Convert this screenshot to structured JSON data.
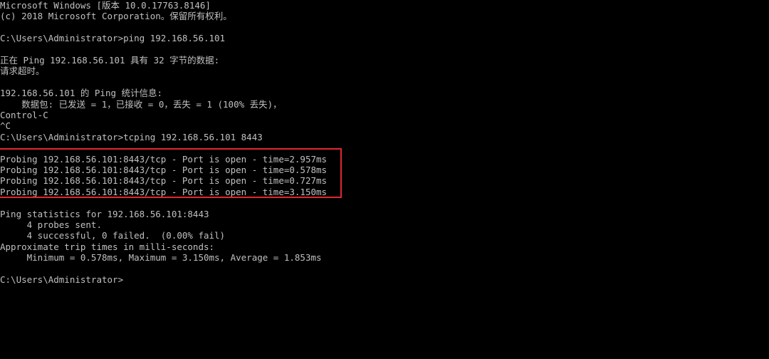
{
  "terminal": {
    "lines": [
      {
        "row": 0,
        "text": "Microsoft Windows [版本 10.0.17763.8146]"
      },
      {
        "row": 1,
        "text": "(c) 2018 Microsoft Corporation。保留所有权利。"
      },
      {
        "row": 2,
        "text": ""
      },
      {
        "row": 3,
        "text": "C:\\Users\\Administrator>ping 192.168.56.101"
      },
      {
        "row": 4,
        "text": ""
      },
      {
        "row": 5,
        "text": "正在 Ping 192.168.56.101 具有 32 字节的数据:"
      },
      {
        "row": 6,
        "text": "请求超时。"
      },
      {
        "row": 7,
        "text": ""
      },
      {
        "row": 8,
        "text": "192.168.56.101 的 Ping 统计信息:"
      },
      {
        "row": 9,
        "text": "    数据包: 已发送 = 1，已接收 = 0，丢失 = 1 (100% 丢失)，"
      },
      {
        "row": 10,
        "text": "Control-C"
      },
      {
        "row": 11,
        "text": "^C"
      },
      {
        "row": 12,
        "text": "C:\\Users\\Administrator>tcping 192.168.56.101 8443"
      },
      {
        "row": 13,
        "text": ""
      },
      {
        "row": 14,
        "text": "Probing 192.168.56.101:8443/tcp - Port is open - time=2.957ms"
      },
      {
        "row": 15,
        "text": "Probing 192.168.56.101:8443/tcp - Port is open - time=0.578ms"
      },
      {
        "row": 16,
        "text": "Probing 192.168.56.101:8443/tcp - Port is open - time=0.727ms"
      },
      {
        "row": 17,
        "text": "Probing 192.168.56.101:8443/tcp - Port is open - time=3.150ms"
      },
      {
        "row": 18,
        "text": ""
      },
      {
        "row": 19,
        "text": "Ping statistics for 192.168.56.101:8443"
      },
      {
        "row": 20,
        "text": "     4 probes sent."
      },
      {
        "row": 21,
        "text": "     4 successful, 0 failed.  (0.00% fail)"
      },
      {
        "row": 22,
        "text": "Approximate trip times in milli-seconds:"
      },
      {
        "row": 23,
        "text": "     Minimum = 0.578ms, Maximum = 3.150ms, Average = 1.853ms"
      },
      {
        "row": 24,
        "text": ""
      },
      {
        "row": 25,
        "text": "C:\\Users\\Administrator>"
      }
    ]
  },
  "colors": {
    "background": "#000000",
    "text": "#c0c0c0",
    "highlight_border": "#e0282e"
  }
}
